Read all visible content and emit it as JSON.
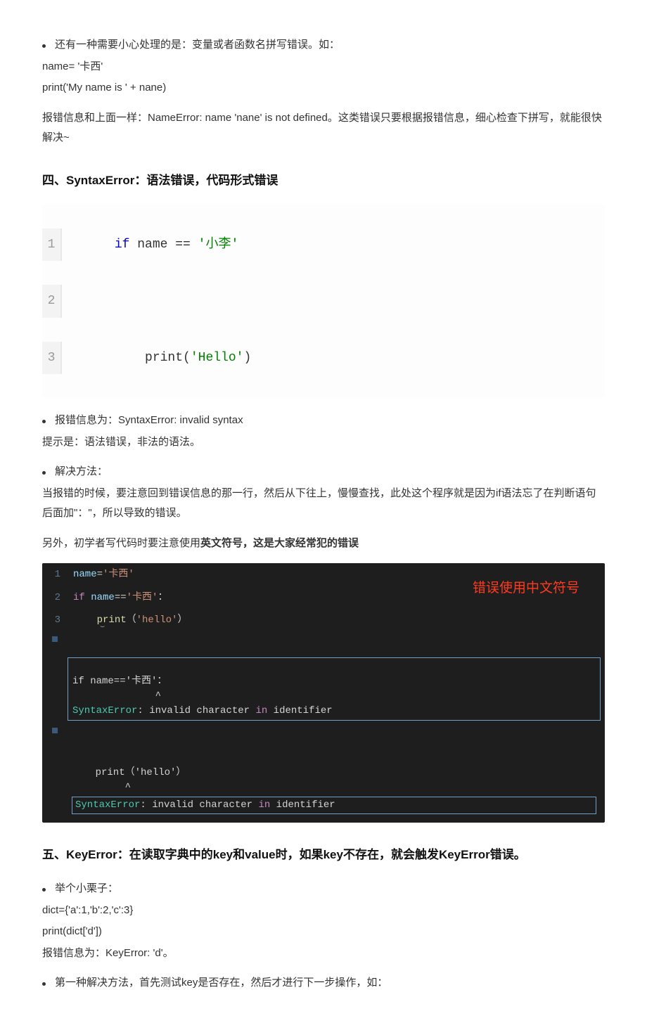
{
  "intro": {
    "bullet1": "还有一种需要小心处理的是：变量或者函数名拼写错误。如：",
    "code1": "name= '卡西'",
    "code2": "print('My name is ' + nane)",
    "note": "报错信息和上面一样：NameError: name 'nane' is not defined。这类错误只要根据报错信息，细心检查下拼写，就能很快解决~"
  },
  "sec4": {
    "title": "四、SyntaxError：语法错误，代码形式错误",
    "code": {
      "l1": {
        "n": "1",
        "t_pre": "if",
        "t_mid": " name == ",
        "t_str": "'小李'"
      },
      "l2": {
        "n": "2",
        "t": ""
      },
      "l3": {
        "n": "3",
        "t_pre": "    print(",
        "t_str": "'Hello'",
        "t_post": ")"
      }
    },
    "b1": "报错信息为：SyntaxError: invalid syntax",
    "p1": "提示是：语法错误，非法的语法。",
    "b2": "解决方法：",
    "p2": "当报错的时候，要注意回到错误信息的那一行，然后从下往上，慢慢查找，此处这个程序就是因为if语法忘了在判断语句后面加\"：\"，所以导致的错误。",
    "p3_a": "另外，初学者写代码时要注意使用",
    "p3_b": "英文符号，这是大家经常犯的错误"
  },
  "dark": {
    "l1": {
      "n": "1",
      "var": "name",
      "eq": "=",
      "str": "'卡西'"
    },
    "l2": {
      "n": "2",
      "kw": "if",
      "var": " name",
      "eq": "==",
      "str": "'卡西'",
      "colon": "："
    },
    "l3": {
      "n": "3",
      "indent": "    ",
      "fun": "print",
      "paren": "（",
      "str": "'hello'",
      "paren2": "）"
    },
    "annot": "错误使用中文符号",
    "out1_l1": "if name=='卡西'：",
    "out1_l2": "              ^",
    "out1_l3a": "SyntaxError",
    "out1_l3b": ": invalid character ",
    "out1_l3c": "in",
    "out1_l3d": " identifier",
    "out2_l1": "    print（'hello'）",
    "out2_l2": "         ^",
    "out2_l3a": "SyntaxError",
    "out2_l3b": ": invalid character ",
    "out2_l3c": "in",
    "out2_l3d": " identifier"
  },
  "sec5": {
    "title": "五、KeyError：在读取字典中的key和value时，如果key不存在，就会触发KeyError错误。",
    "b1": "举个小栗子：",
    "c1": "dict={'a':1,'b':2,'c':3}",
    "c2": "print(dict['d'])",
    "c3": "报错信息为：KeyError: 'd'。",
    "b2": "第一种解决方法，首先测试key是否存在，然后才进行下一步操作，如："
  }
}
